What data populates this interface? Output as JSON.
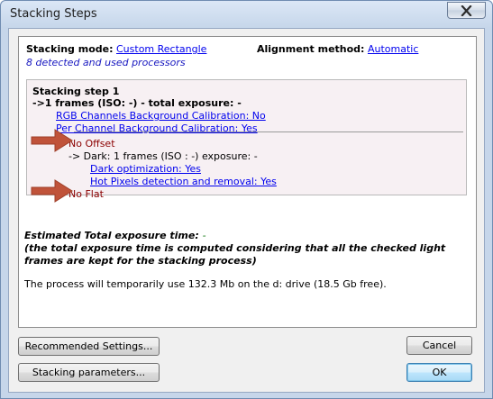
{
  "window": {
    "title": "Stacking Steps"
  },
  "header": {
    "stacking_mode_label": "Stacking mode:",
    "stacking_mode_value": "Custom Rectangle",
    "alignment_label": "Alignment method:",
    "alignment_value": "Automatic",
    "processors_text": "8 detected and used processors"
  },
  "step": {
    "title": "Stacking step 1",
    "frames_line": "->1 frames (ISO: -) - total exposure: -",
    "rgb_calibration": "RGB Channels Background Calibration: No",
    "per_channel_calibration": "Per Channel Background Calibration: Yes",
    "no_offset": "No Offset",
    "dark_line": "-> Dark: 1 frames (ISO : -) exposure: -",
    "dark_optimization": "Dark optimization: Yes",
    "hot_pixels": "Hot Pixels detection and removal: Yes",
    "no_flat": "No Flat"
  },
  "estimate": {
    "label": "Estimated Total exposure time:",
    "value": "-",
    "note": "(the total exposure time is computed considering that all the checked light frames are kept for the stacking process)"
  },
  "process_text": "The process will temporarily use 132.3 Mb on the d: drive (18.5 Gb free).",
  "buttons": {
    "recommended": "Recommended Settings...",
    "stacking_params": "Stacking parameters...",
    "cancel": "Cancel",
    "ok": "OK"
  },
  "colors": {
    "arrow": "#c0533a",
    "link": "#0000ee",
    "dark_red": "#8b0000",
    "step_background": "#f7f0f3"
  },
  "icons": {
    "close": "close-icon",
    "annotation_arrow": "arrow-right-icon"
  }
}
